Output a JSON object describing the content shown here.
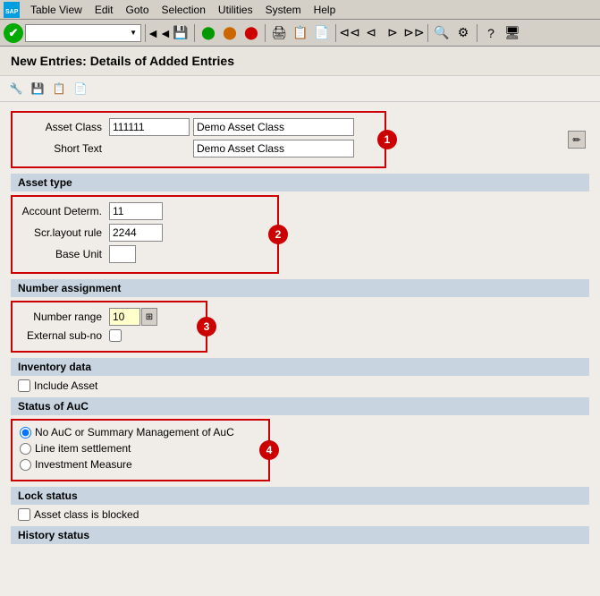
{
  "menubar": {
    "logo": "SAP",
    "items": [
      {
        "label": "Table View",
        "id": "table-view"
      },
      {
        "label": "Edit",
        "id": "edit"
      },
      {
        "label": "Goto",
        "id": "goto"
      },
      {
        "label": "Selection",
        "id": "selection"
      },
      {
        "label": "Utilities",
        "id": "utilities"
      },
      {
        "label": "System",
        "id": "system"
      },
      {
        "label": "Help",
        "id": "help"
      }
    ]
  },
  "toolbar": {
    "dropdown_placeholder": ""
  },
  "page": {
    "title": "New Entries: Details of Added Entries"
  },
  "form": {
    "asset_class_label": "Asset Class",
    "asset_class_code": "111111",
    "asset_class_name": "Demo Asset Class",
    "short_text_label": "Short Text",
    "short_text_value": "Demo Asset Class",
    "badge1": "1",
    "section_asset_type": "Asset type",
    "account_determ_label": "Account Determ.",
    "account_determ_value": "11",
    "scr_layout_label": "Scr.layout rule",
    "scr_layout_value": "2244",
    "base_unit_label": "Base Unit",
    "base_unit_value": "",
    "badge2": "2",
    "section_number": "Number assignment",
    "number_range_label": "Number range",
    "number_range_value": "10",
    "external_subno_label": "External sub-no",
    "badge3": "3",
    "section_inventory": "Inventory data",
    "include_asset_label": "Include Asset",
    "section_auc": "Status of AuC",
    "radio_no_auc": "No AuC or Summary Management of AuC",
    "radio_line_item": "Line item settlement",
    "radio_investment": "Investment Measure",
    "badge4": "4",
    "section_lock": "Lock status",
    "asset_blocked_label": "Asset class is blocked",
    "section_history": "History status"
  },
  "icons": {
    "save": "💾",
    "back": "◀",
    "forward": "▶",
    "nav_back": "◁",
    "nav_forward": "▷",
    "find": "🔍",
    "print": "🖨",
    "check": "✔",
    "edit_pencil": "✏",
    "first": "⏮",
    "last": "⏭",
    "help": "?",
    "monitor": "🖥"
  }
}
